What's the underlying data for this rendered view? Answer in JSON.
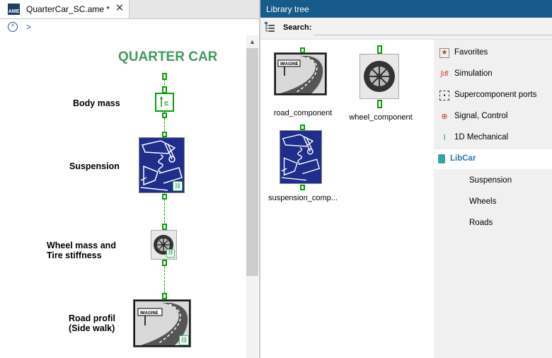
{
  "editor": {
    "app_icon_text": "AME",
    "tab_title": "QuarterCar_SC.ame *",
    "close_glyph": "✕",
    "nav_up_glyph": "^",
    "nav_chevron": ">"
  },
  "diagram": {
    "title": "QUARTER CAR",
    "labels": {
      "body_mass": "Body mass",
      "suspension": "Suspension",
      "wheel": "Wheel mass and\nTire stiffness",
      "road": "Road profil\n(Side walk)"
    },
    "road_sign_text": "IMAGINE",
    "mass_symbol": "M"
  },
  "library": {
    "header_title": "Library tree",
    "search_label": "Search:",
    "search_value": "",
    "components": [
      {
        "label": "road_component",
        "icon": "road-icon"
      },
      {
        "label": "wheel_component",
        "icon": "wheel-icon"
      },
      {
        "label": "suspension_comp...",
        "icon": "suspension-icon"
      }
    ],
    "road_sign_text": "IMAGINE",
    "categories": [
      {
        "label": "Favorites",
        "icon": "star-icon"
      },
      {
        "label": "Simulation",
        "icon": "integral-icon"
      },
      {
        "label": "Supercomponent ports",
        "icon": "ports-icon"
      },
      {
        "label": "Signal, Control",
        "icon": "signal-icon"
      },
      {
        "label": "1D Mechanical",
        "icon": "spring-icon"
      },
      {
        "label": "LibCar",
        "icon": "library-icon",
        "selected": true
      }
    ],
    "subcategories": [
      "Suspension",
      "Wheels",
      "Roads"
    ]
  },
  "colors": {
    "header_blue": "#165b8a",
    "diagram_title_green": "#3c9c5c",
    "port_green": "#0a9c0a",
    "selected_text": "#2a7ab4",
    "suspension_blue": "#1e2e8a"
  }
}
